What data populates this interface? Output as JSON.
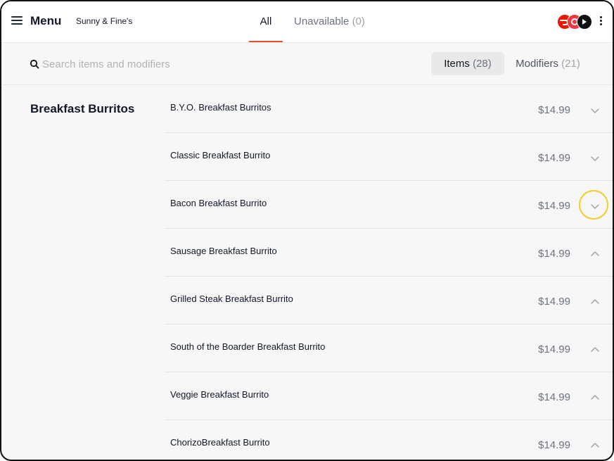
{
  "header": {
    "menu_label": "Menu",
    "store_name": "Sunny & Fine's",
    "tabs": [
      {
        "label": "All",
        "count": ""
      },
      {
        "label": "Unavailable",
        "count": "(0)"
      }
    ],
    "logos": [
      "doordash-logo-icon",
      "grubhub-logo-icon",
      "postmates-logo-icon"
    ],
    "accent_color": "#e8532f"
  },
  "search": {
    "placeholder": "Search items and modifiers",
    "value": ""
  },
  "segments": [
    {
      "label": "Items",
      "count": "(28)"
    },
    {
      "label": "Modifiers",
      "count": "(21)"
    }
  ],
  "category": {
    "name": "Breakfast Burritos"
  },
  "items": [
    {
      "name": "B.Y.O. Breakfast Burritos",
      "price": "$14.99",
      "chevron": "chevron-down-icon"
    },
    {
      "name": "Classic Breakfast Burrito",
      "price": "$14.99",
      "chevron": "chevron-down-icon"
    },
    {
      "name": "Bacon Breakfast Burrito",
      "price": "$14.99",
      "chevron": "chevron-down-icon"
    },
    {
      "name": "Sausage Breakfast Burrito",
      "price": "$14.99",
      "chevron": "chevron-up-icon"
    },
    {
      "name": "Grilled Steak Breakfast Burrito",
      "price": "$14.99",
      "chevron": "chevron-up-icon"
    },
    {
      "name": "South of the Boarder Breakfast Burrito",
      "price": "$14.99",
      "chevron": "chevron-up-icon"
    },
    {
      "name": "Veggie Breakfast Burrito",
      "price": "$14.99",
      "chevron": "chevron-up-icon"
    },
    {
      "name": "ChorizoBreakfast Burrito",
      "price": "$14.99",
      "chevron": "chevron-up-icon"
    }
  ]
}
